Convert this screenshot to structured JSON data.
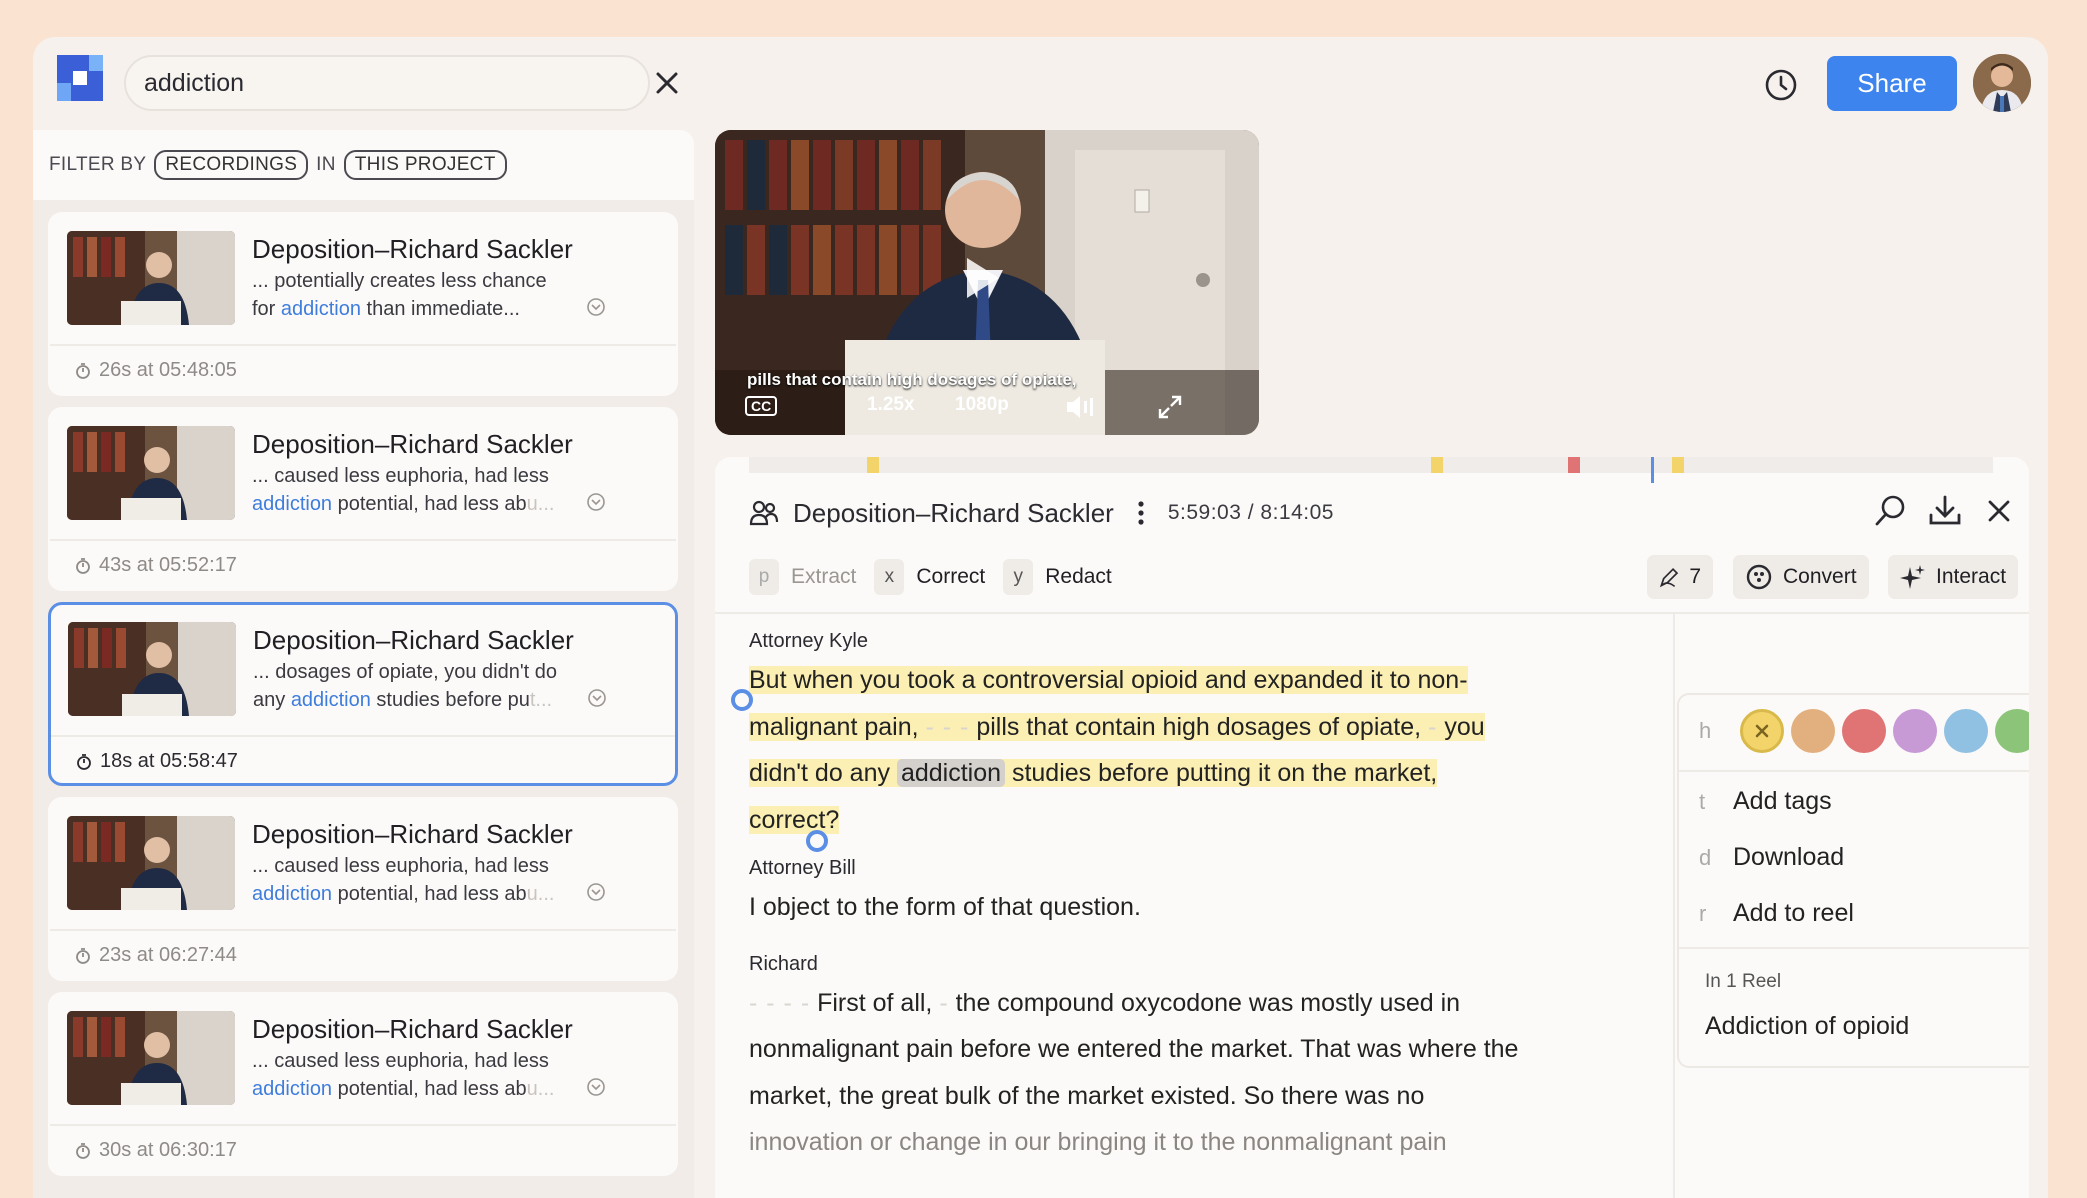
{
  "search": {
    "query": "addiction"
  },
  "header": {
    "share_label": "Share"
  },
  "filter": {
    "label": "FILTER BY",
    "scope": "RECORDINGS",
    "in_label": "IN",
    "location": "THIS PROJECT"
  },
  "results": [
    {
      "title": "Deposition–Richard Sackler",
      "line1": "... potentially creates less chance",
      "pre": "for ",
      "term": "addiction",
      "post": " than immediate",
      "fade": "...",
      "time": "26s at 05:48:05"
    },
    {
      "title": "Deposition–Richard Sackler",
      "line1": "... caused less euphoria, had less",
      "pre": "",
      "term": "addiction",
      "post": " potential, had less ab",
      "fade": "u...",
      "time": "43s at 05:52:17"
    },
    {
      "title": "Deposition–Richard Sackler",
      "line1": "... dosages of opiate, you didn't do",
      "pre": "any ",
      "term": "addiction",
      "post": " studies before pu",
      "fade": "t...",
      "time": "18s at 05:58:47"
    },
    {
      "title": "Deposition–Richard Sackler",
      "line1": "... caused less euphoria, had less",
      "pre": "",
      "term": "addiction",
      "post": " potential, had less ab",
      "fade": "u...",
      "time": "23s at 06:27:44"
    },
    {
      "title": "Deposition–Richard Sackler",
      "line1": "... caused less euphoria, had less",
      "pre": "",
      "term": "addiction",
      "post": " potential, had less ab",
      "fade": "u...",
      "time": "30s at 06:30:17"
    }
  ],
  "video": {
    "subtitle_line1": "pills that contain high dosages of opiate,",
    "speed": "1.25x",
    "quality": "1080p",
    "cc": "CC"
  },
  "transcript_panel": {
    "title": "Deposition–Richard Sackler",
    "time": "5:59:03 / 8:14:05",
    "tools": [
      {
        "key": "p",
        "label": "Extract"
      },
      {
        "key": "x",
        "label": "Correct"
      },
      {
        "key": "y",
        "label": "Redact"
      }
    ],
    "edit_count": "7",
    "convert_label": "Convert",
    "interact_label": "Interact"
  },
  "transcript": {
    "s1": "Attorney Kyle",
    "p1a": "But when you took a controversial opioid and expanded it to non-",
    "p1b": "malignant pain, ",
    "p1c": " pills that contain high dosages of opiate, ",
    "p1d": " you",
    "p1e": "didn't do any ",
    "p1term": "addiction",
    "p1f": " studies before putting it on the market,",
    "p1g": "correct?",
    "s2": "Attorney Bill",
    "p2": "I object to the form of that question.",
    "s3": "Richard",
    "p3a": " First of all, ",
    "p3b": " the compound oxycodone was mostly used in",
    "p3c": "nonmalignant pain before we entered the market. That was where the",
    "p3d": "market, the great bulk of the market existed. So there was no",
    "p3e": "innovation or change in our bringing it to the nonmalignant pain"
  },
  "context_menu": {
    "color_key": "h",
    "colors": [
      "#f2d46a",
      "#e2b07e",
      "#e07373",
      "#c79ad6",
      "#90c0e2",
      "#8cc47a"
    ],
    "items": [
      {
        "key": "t",
        "label": "Add tags"
      },
      {
        "key": "d",
        "label": "Download"
      },
      {
        "key": "r",
        "label": "Add to reel"
      }
    ],
    "reel_caption": "In 1 Reel",
    "reel_name": "Addiction of opioid"
  },
  "timeline_marks": [
    {
      "pos": 0.095,
      "color": "#f2d46a"
    },
    {
      "pos": 0.548,
      "color": "#f2d46a"
    },
    {
      "pos": 0.658,
      "color": "#e07373"
    },
    {
      "pos": 0.742,
      "color": "#f2d46a"
    }
  ]
}
